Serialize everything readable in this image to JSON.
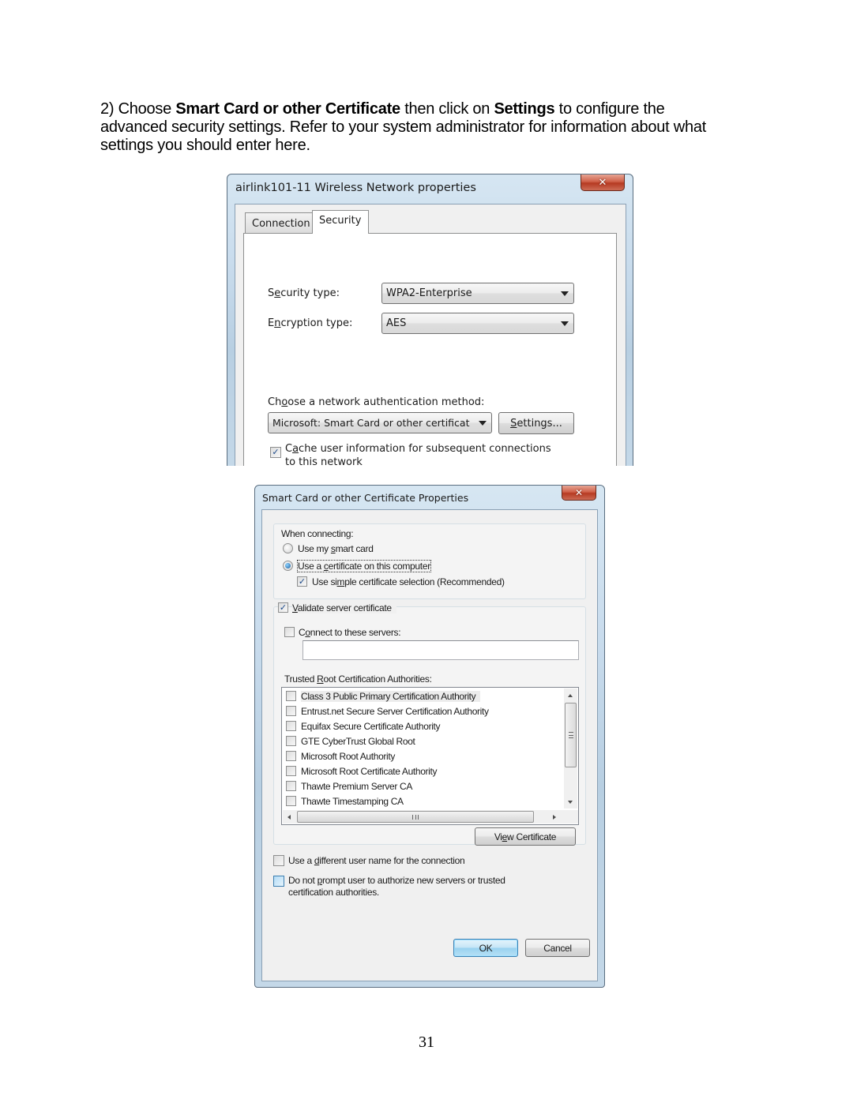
{
  "document": {
    "instruction": {
      "prefix": "2) Choose ",
      "bold1": "Smart Card or other Certificate",
      "middle": " then click on ",
      "bold2": "Settings",
      "suffix": " to configure the advanced security settings. Refer to your system administrator for information about what settings you should enter here."
    },
    "page_number": "31"
  },
  "window1": {
    "title": "airlink101-11 Wireless Network properties",
    "close_icon": "close-icon",
    "tabs": [
      {
        "label": "Connection",
        "active": false
      },
      {
        "label": "Security",
        "active": true
      }
    ],
    "security_type": {
      "label_pre": "S",
      "label_u": "e",
      "label_post": "curity type:",
      "value": "WPA2-Enterprise"
    },
    "encryption_type": {
      "label_pre": "E",
      "label_u": "n",
      "label_post": "cryption type:",
      "value": "AES"
    },
    "auth_method": {
      "label_pre": "Ch",
      "label_u": "o",
      "label_post": "ose a network authentication method:",
      "value": "Microsoft: Smart Card or other certificat",
      "settings_button_u": "S",
      "settings_button_rest": "ettings..."
    },
    "cache_user_info": {
      "checked": true,
      "label_pre": "C",
      "label_u": "a",
      "label_post": "che user information for subsequent connections",
      "label_line2": "to this network"
    }
  },
  "window2": {
    "title": "Smart Card or other Certificate Properties",
    "close_icon": "close-icon",
    "when_connecting": {
      "label": "When connecting:",
      "options": [
        {
          "pre": "Use my ",
          "u": "s",
          "post": "mart card",
          "selected": false
        },
        {
          "pre": "Use a ",
          "u": "c",
          "post": "ertificate on this computer",
          "selected": true
        }
      ],
      "simple_selection": {
        "pre": "Use si",
        "u": "m",
        "post": "ple certificate selection (Recommended)",
        "checked": true
      }
    },
    "validate_server": {
      "checked": true,
      "u": "V",
      "post": "alidate server certificate",
      "connect_servers": {
        "checked": false,
        "pre": "C",
        "u": "o",
        "post": "nnect to these servers:",
        "value": ""
      },
      "trusted_root_label": {
        "pre": "Trusted ",
        "u": "R",
        "post": "oot Certification Authorities:"
      },
      "authorities": [
        {
          "name": "Class 3 Public Primary Certification Authority",
          "checked": false
        },
        {
          "name": "Entrust.net Secure Server Certification Authority",
          "checked": false
        },
        {
          "name": "Equifax Secure Certificate Authority",
          "checked": false
        },
        {
          "name": "GTE CyberTrust Global Root",
          "checked": false
        },
        {
          "name": "Microsoft Root Authority",
          "checked": false
        },
        {
          "name": "Microsoft Root Certificate Authority",
          "checked": false
        },
        {
          "name": "Thawte Premium Server CA",
          "checked": false
        },
        {
          "name": "Thawte Timestamping CA",
          "checked": false
        }
      ],
      "view_certificate": {
        "pre": "Vi",
        "u": "e",
        "post": "w Certificate"
      }
    },
    "different_user": {
      "checked": false,
      "pre": "Use a ",
      "u": "d",
      "post": "ifferent user name for the connection"
    },
    "do_not_prompt": {
      "checked": false,
      "pre": "Do not ",
      "u": "p",
      "post": "rompt user to authorize new servers or trusted",
      "line2": "certification authorities."
    },
    "ok_label": "OK",
    "cancel_label": "Cancel"
  }
}
